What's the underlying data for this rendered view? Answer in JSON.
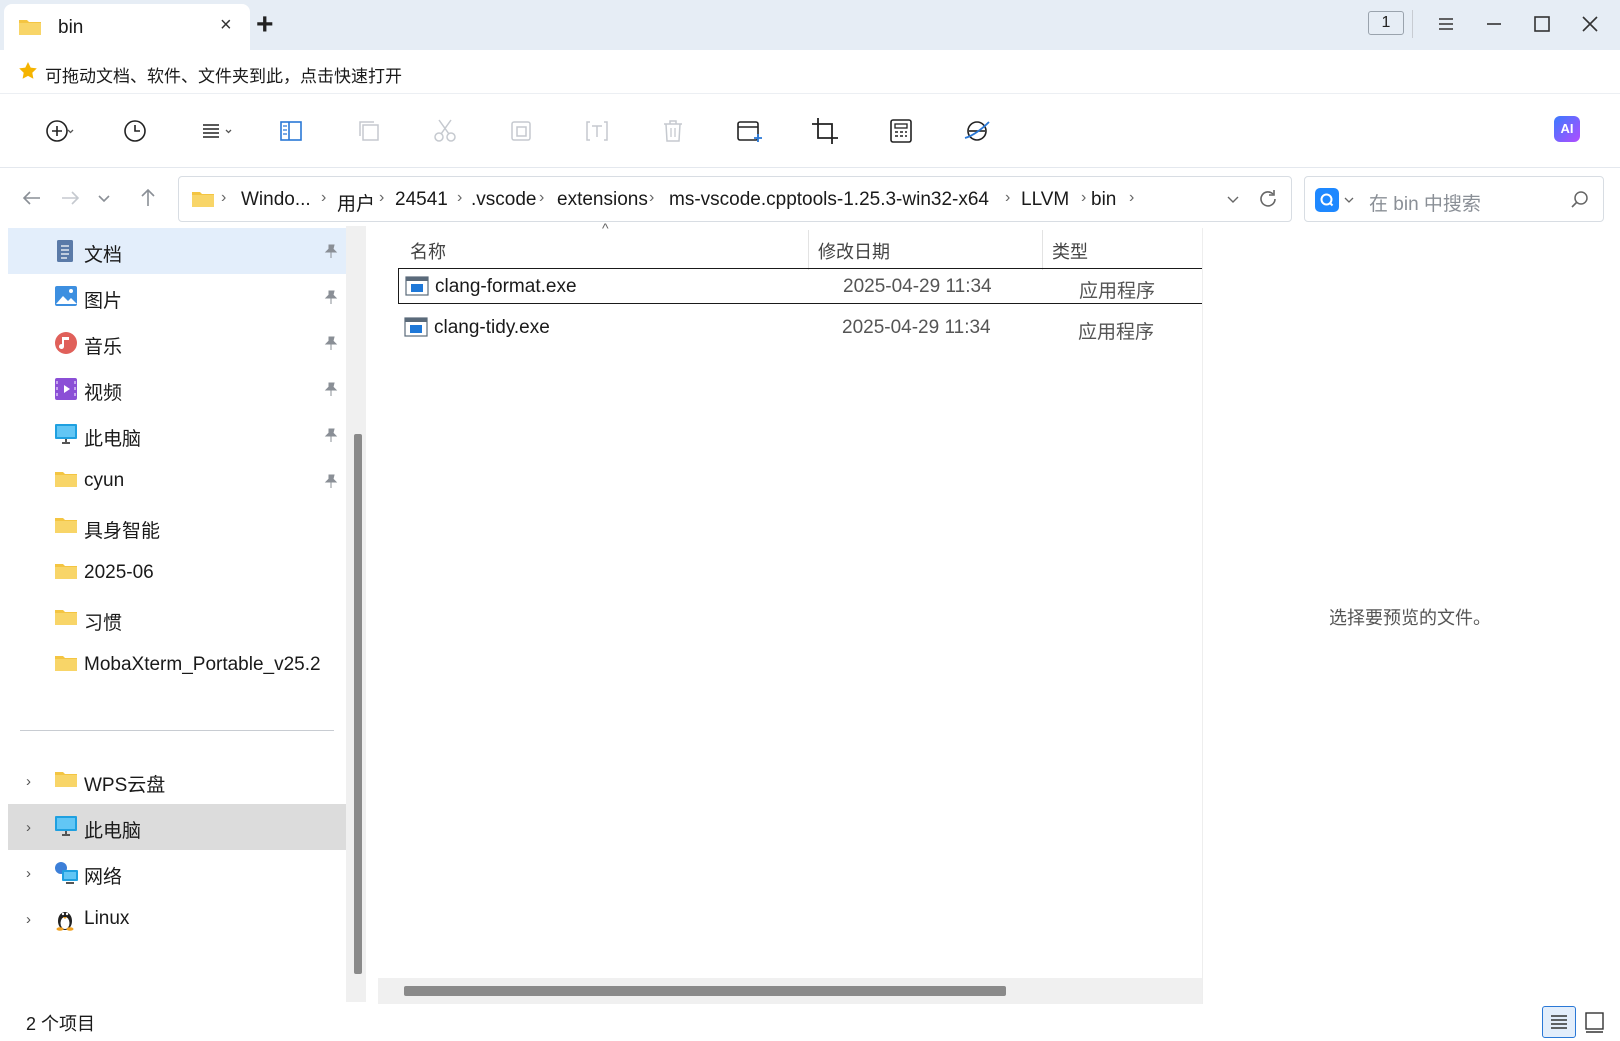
{
  "window": {
    "tab_title": "bin",
    "tab_close": "×",
    "new_tab": "+",
    "window_count": "1"
  },
  "favorites_bar": {
    "hint": "可拖动文档、软件、文件夹到此，点击快速打开"
  },
  "toolbar": {
    "ai_label": "AI"
  },
  "address": {
    "segments": [
      "Windo...",
      "用户",
      "24541",
      ".vscode",
      "extensions",
      "ms-vscode.cpptools-1.25.3-win32-x64",
      "LLVM",
      "bin"
    ],
    "separator": "›",
    "dropdown": "⌵"
  },
  "search": {
    "placeholder": "在 bin 中搜索"
  },
  "sidebar": {
    "pinned": [
      {
        "label": "文档",
        "icon": "document-icon",
        "pinned": true
      },
      {
        "label": "图片",
        "icon": "picture-icon",
        "pinned": true
      },
      {
        "label": "音乐",
        "icon": "music-icon",
        "pinned": true
      },
      {
        "label": "视频",
        "icon": "video-icon",
        "pinned": true
      },
      {
        "label": "此电脑",
        "icon": "computer-icon",
        "pinned": true
      },
      {
        "label": "cyun",
        "icon": "folder-icon",
        "pinned": true
      },
      {
        "label": "具身智能",
        "icon": "folder-icon",
        "pinned": false
      },
      {
        "label": "2025-06",
        "icon": "folder-icon",
        "pinned": false
      },
      {
        "label": "习惯",
        "icon": "folder-icon",
        "pinned": false
      },
      {
        "label": "MobaXterm_Portable_v25.2",
        "icon": "folder-icon",
        "pinned": false
      }
    ],
    "tree": [
      {
        "label": "WPS云盘",
        "icon": "folder-icon"
      },
      {
        "label": "此电脑",
        "icon": "computer-icon",
        "selected": true
      },
      {
        "label": "网络",
        "icon": "network-icon"
      },
      {
        "label": "Linux",
        "icon": "linux-icon"
      }
    ],
    "chevron": "›"
  },
  "file_list": {
    "columns": {
      "name": "名称",
      "date": "修改日期",
      "type": "类型"
    },
    "files": [
      {
        "name": "clang-format.exe",
        "date": "2025-04-29 11:34",
        "type": "应用程序",
        "selected": true
      },
      {
        "name": "clang-tidy.exe",
        "date": "2025-04-29 11:34",
        "type": "应用程序",
        "selected": false
      }
    ]
  },
  "preview": {
    "empty_text": "选择要预览的文件。"
  },
  "status": {
    "item_count": "2 个项目"
  }
}
